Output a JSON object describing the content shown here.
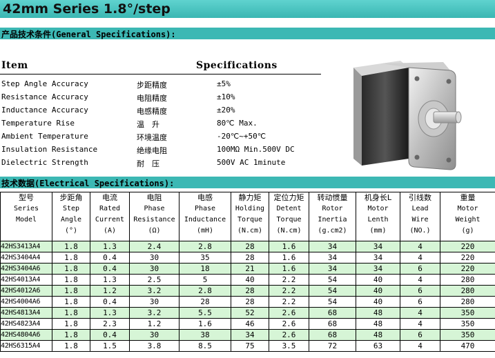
{
  "title": "42mm Series 1.8°/step",
  "general": {
    "section_label": "产品技术条件(General Specifications):",
    "col_item": "Item",
    "col_spec": "Specifications",
    "rows": [
      {
        "en": "Step Angle Accuracy",
        "cn": "步距精度",
        "value": "±5%"
      },
      {
        "en": "Resistance Accuracy",
        "cn": "电阻精度",
        "value": "±10%"
      },
      {
        "en": "Inductance Accuracy",
        "cn": "电感精度",
        "value": "±20%"
      },
      {
        "en": "Temperature Rise",
        "cn": "温　升",
        "value": "80℃ Max."
      },
      {
        "en": "Ambient Temperature",
        "cn": "环境温度",
        "value": "-20℃~+50℃"
      },
      {
        "en": "Insulation Resistance",
        "cn": "绝缘电阻",
        "value": "100MΩ  Min.500V DC"
      },
      {
        "en": "Dielectric Strength",
        "cn": "耐　压",
        "value": "500V AC 1minute"
      }
    ]
  },
  "electrical": {
    "section_label": "技术数据(Electrical Specifications):",
    "headers": [
      {
        "cn": "型号",
        "en": [
          "Series",
          "Model"
        ]
      },
      {
        "cn": "步距角",
        "en": [
          "Step",
          "Angle",
          "(°)"
        ]
      },
      {
        "cn": "电流",
        "en": [
          "Rated",
          "Current",
          "(A)"
        ]
      },
      {
        "cn": "电阻",
        "en": [
          "Phase",
          "Resistance",
          "(Ω)"
        ]
      },
      {
        "cn": "电感",
        "en": [
          "Phase",
          "Inductance",
          "(mH)"
        ]
      },
      {
        "cn": "静力矩",
        "en": [
          "Holding",
          "Torque",
          "(N.cm)"
        ]
      },
      {
        "cn": "定位力矩",
        "en": [
          "Detent",
          "Torque",
          "(N.cm)"
        ]
      },
      {
        "cn": "转动惯量",
        "en": [
          "Rotor",
          "Inertia",
          "(g.cm2)"
        ]
      },
      {
        "cn": "机身长L",
        "en": [
          "Motor",
          "Lenth",
          "(mm)"
        ]
      },
      {
        "cn": "引线数",
        "en": [
          "Lead",
          "Wire",
          "(NO.)"
        ]
      },
      {
        "cn": "重量",
        "en": [
          "Motor",
          "Weight",
          "(g)"
        ]
      }
    ],
    "rows": [
      [
        "42HS3413A4",
        "1.8",
        "1.3",
        "2.4",
        "2.8",
        "28",
        "1.6",
        "34",
        "34",
        "4",
        "220"
      ],
      [
        "42HS3404A4",
        "1.8",
        "0.4",
        "30",
        "35",
        "28",
        "1.6",
        "34",
        "34",
        "4",
        "220"
      ],
      [
        "42HS3404A6",
        "1.8",
        "0.4",
        "30",
        "18",
        "21",
        "1.6",
        "34",
        "34",
        "6",
        "220"
      ],
      [
        "42HS4013A4",
        "1.8",
        "1.3",
        "2.5",
        "5",
        "40",
        "2.2",
        "54",
        "40",
        "4",
        "280"
      ],
      [
        "42HS4012A6",
        "1.8",
        "1.2",
        "3.2",
        "2.8",
        "28",
        "2.2",
        "54",
        "40",
        "6",
        "280"
      ],
      [
        "42HS4004A6",
        "1.8",
        "0.4",
        "30",
        "28",
        "28",
        "2.2",
        "54",
        "40",
        "6",
        "280"
      ],
      [
        "42HS4813A4",
        "1.8",
        "1.3",
        "3.2",
        "5.5",
        "52",
        "2.6",
        "68",
        "48",
        "4",
        "350"
      ],
      [
        "42HS4823A4",
        "1.8",
        "2.3",
        "1.2",
        "1.6",
        "46",
        "2.6",
        "68",
        "48",
        "4",
        "350"
      ],
      [
        "42HS4804A6",
        "1.8",
        "0.4",
        "30",
        "38",
        "34",
        "2.6",
        "68",
        "48",
        "6",
        "350"
      ],
      [
        "42HS6315A4",
        "1.8",
        "1.5",
        "3.8",
        "8.5",
        "75",
        "3.5",
        "72",
        "63",
        "4",
        "470"
      ]
    ]
  },
  "colors": {
    "header_teal": "#3cb8b4",
    "row_highlight": "#d6f5d6"
  }
}
